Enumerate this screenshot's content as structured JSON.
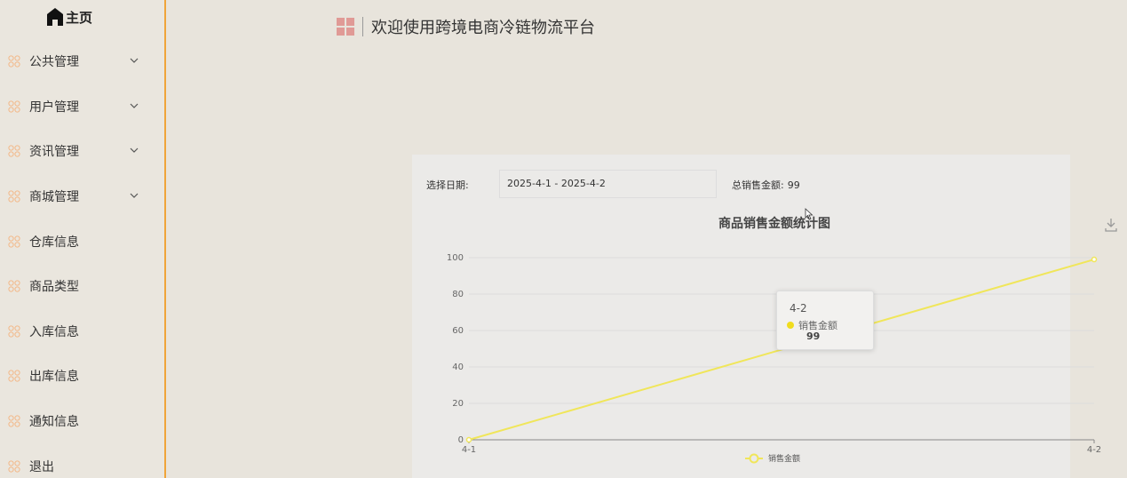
{
  "sidebar": {
    "home_label": "主页",
    "items": [
      {
        "label": "公共管理",
        "expandable": true
      },
      {
        "label": "用户管理",
        "expandable": true
      },
      {
        "label": "资讯管理",
        "expandable": true
      },
      {
        "label": "商城管理",
        "expandable": true
      },
      {
        "label": "仓库信息",
        "expandable": false
      },
      {
        "label": "商品类型",
        "expandable": false
      },
      {
        "label": "入库信息",
        "expandable": false
      },
      {
        "label": "出库信息",
        "expandable": false
      },
      {
        "label": "通知信息",
        "expandable": false
      },
      {
        "label": "退出",
        "expandable": false
      }
    ],
    "icon_color": "#f3b98a",
    "accent_color": "#f0a43a"
  },
  "header": {
    "title": "欢迎使用跨境电商冷链物流平台",
    "icon_color": "#e09a96"
  },
  "filter": {
    "date_label": "选择日期:",
    "date_range": "2025-4-1 - 2025-4-2",
    "total_label": "总销售金额:",
    "total_value": "99"
  },
  "chart_data": {
    "type": "line",
    "title": "商品销售金额统计图",
    "categories": [
      "4-1",
      "4-2"
    ],
    "series": [
      {
        "name": "销售金额",
        "values": [
          0,
          99
        ],
        "color": "#f0e65a"
      }
    ],
    "ylim": [
      0,
      100
    ],
    "yticks": [
      0,
      20,
      40,
      60,
      80,
      100
    ],
    "grid": true,
    "legend": "bottom-center"
  },
  "tooltip": {
    "category": "4-2",
    "series_name": "销售金额",
    "value": "99"
  }
}
